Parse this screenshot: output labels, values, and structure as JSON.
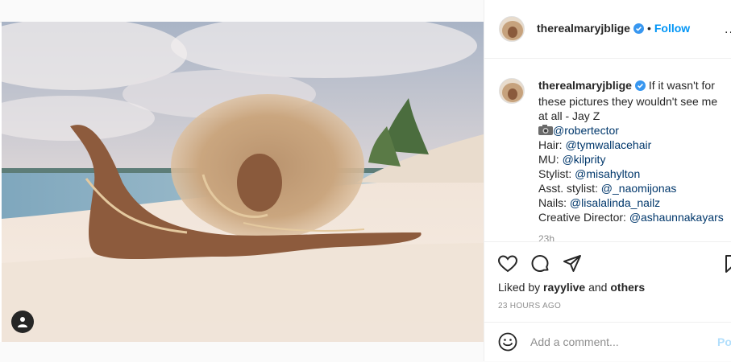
{
  "post": {
    "username": "therealmaryjblige",
    "follow_separator": "•",
    "follow_label": "Follow",
    "more_label": "..."
  },
  "caption": {
    "username": "therealmaryjblige",
    "lines": [
      {
        "text": "If it wasn't for"
      },
      {
        "text": "these pictures they wouldn't see me"
      },
      {
        "text": "at all - Jay Z"
      }
    ],
    "credits": [
      {
        "label": "",
        "handle": "@robertector",
        "icon": "camera-emoji"
      },
      {
        "label": "Hair: ",
        "handle": "@tymwallacehair"
      },
      {
        "label": "MU: ",
        "handle": "@kilprity"
      },
      {
        "label": "Stylist: ",
        "handle": "@misahylton"
      },
      {
        "label": "Asst. stylist: ",
        "handle": "@_naomijonas"
      },
      {
        "label": "Nails: ",
        "handle": "@lisalalinda_nailz"
      },
      {
        "label": "Creative Director: ",
        "handle": "@ashaunnakayars"
      }
    ],
    "time_ago": "23h"
  },
  "engagement": {
    "liked_by_prefix": "Liked by",
    "liked_by_user": "rayylive",
    "liked_by_and": "and",
    "liked_by_others": "others",
    "timestamp": "23 HOURS AGO"
  },
  "comment": {
    "placeholder": "Add a comment...",
    "post_label": "Post"
  },
  "colors": {
    "accent": "#0095f6",
    "verified": "#3897f0",
    "link": "#00376b",
    "muted": "#8e8e8e"
  },
  "icons": [
    "verified-badge-icon",
    "heart-icon",
    "comment-icon",
    "share-icon",
    "save-icon",
    "emoji-icon",
    "user-tag-icon",
    "camera-emoji"
  ]
}
